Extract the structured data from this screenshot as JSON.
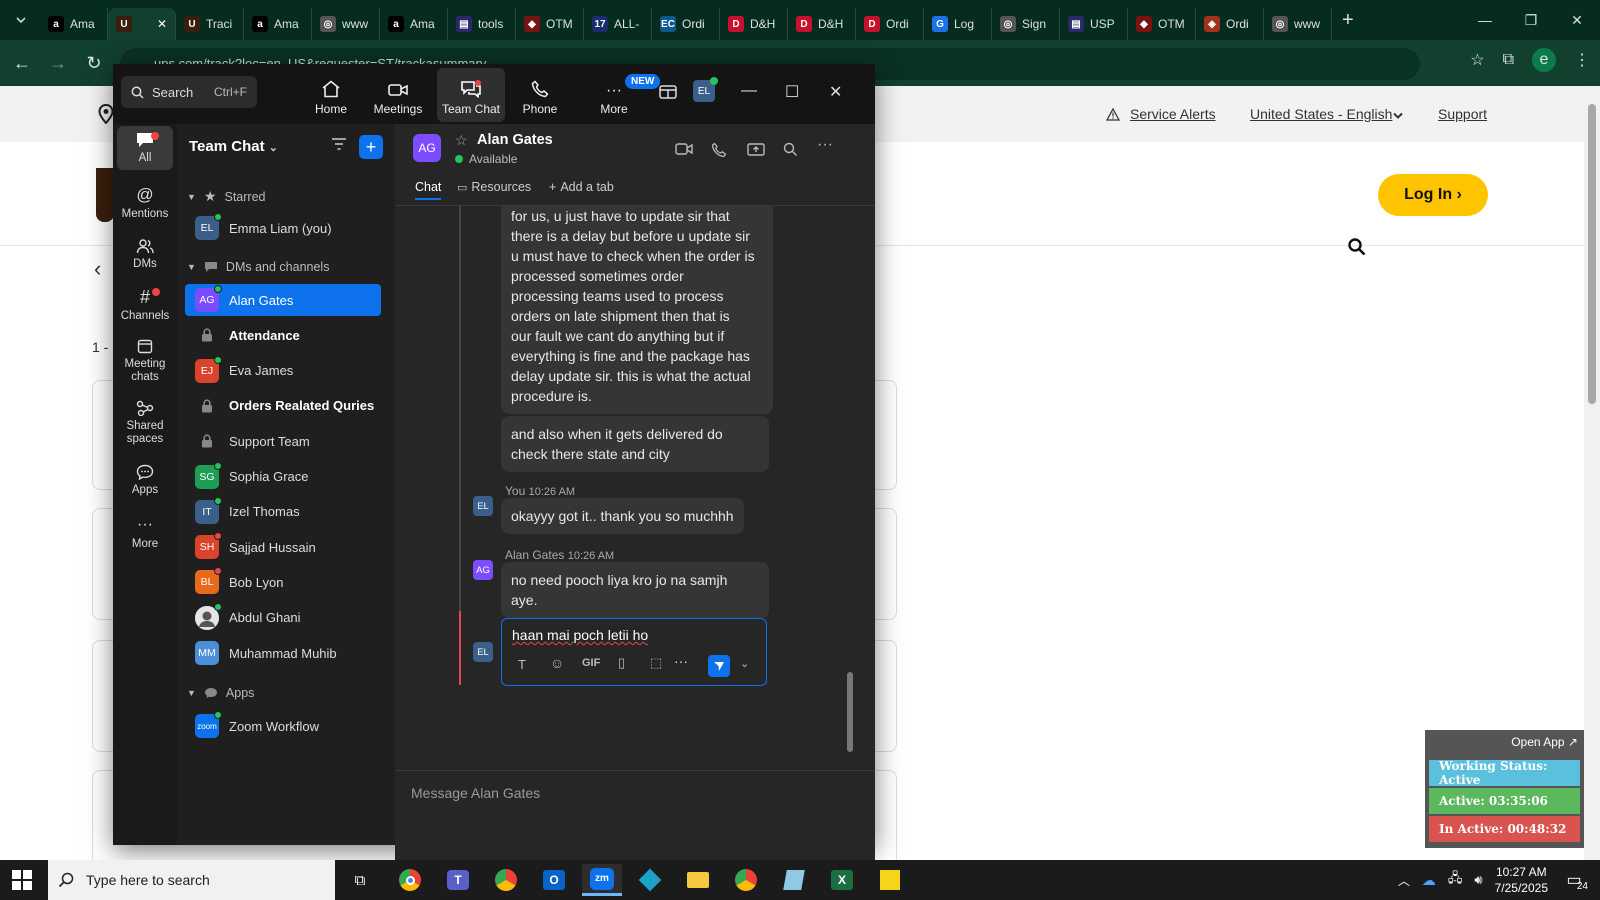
{
  "browser": {
    "tabs": [
      {
        "title": "Ama",
        "fav_color": "#000000",
        "fav_glyph": "a"
      },
      {
        "title": "",
        "fav_color": "#3b1f0e",
        "fav_glyph": "U"
      },
      {
        "title": "Traci",
        "fav_color": "#3b1f0e",
        "fav_glyph": "U"
      },
      {
        "title": "Ama",
        "fav_color": "#000000",
        "fav_glyph": "a"
      },
      {
        "title": "www",
        "fav_color": "#555555",
        "fav_glyph": "◎"
      },
      {
        "title": "Ama",
        "fav_color": "#000000",
        "fav_glyph": "a"
      },
      {
        "title": "tools",
        "fav_color": "#2a2a6a",
        "fav_glyph": "▤"
      },
      {
        "title": "OTM",
        "fav_color": "#7a1212",
        "fav_glyph": "◆"
      },
      {
        "title": "ALL-",
        "fav_color": "#1c2d6b",
        "fav_glyph": "17"
      },
      {
        "title": "Ordi",
        "fav_color": "#0b5a8c",
        "fav_glyph": "EC"
      },
      {
        "title": "D&H",
        "fav_color": "#c8102e",
        "fav_glyph": "D"
      },
      {
        "title": "D&H",
        "fav_color": "#c8102e",
        "fav_glyph": "D"
      },
      {
        "title": "Ordi",
        "fav_color": "#c8102e",
        "fav_glyph": "D"
      },
      {
        "title": "Log",
        "fav_color": "#1a73e8",
        "fav_glyph": "G"
      },
      {
        "title": "Sign",
        "fav_color": "#555555",
        "fav_glyph": "◎"
      },
      {
        "title": "USP",
        "fav_color": "#2a2a6a",
        "fav_glyph": "▤"
      },
      {
        "title": "OTM",
        "fav_color": "#7a1212",
        "fav_glyph": "◆"
      },
      {
        "title": "Ordi",
        "fav_color": "#a3321a",
        "fav_glyph": "◈"
      },
      {
        "title": "www",
        "fav_color": "#555555",
        "fav_glyph": "◎"
      }
    ],
    "url": "ups.com/track?loc=en_US&requester=ST/trackasummary",
    "profile_initial": "e"
  },
  "ups": {
    "service_alerts": "Service Alerts",
    "language": "United States - English",
    "support": "Support",
    "login": "Log In",
    "results_count": "1 - "
  },
  "zoom": {
    "search_placeholder": "Search",
    "search_shortcut": "Ctrl+F",
    "nav_tabs": [
      "Home",
      "Meetings",
      "Team Chat",
      "Phone",
      "More"
    ],
    "new_badge": "NEW",
    "user_initials": "EL",
    "rail": [
      "All",
      "Mentions",
      "DMs",
      "Channels",
      "Meeting chats",
      "Shared spaces",
      "Apps",
      "More"
    ],
    "sidebar": {
      "title": "Team Chat",
      "starred_label": "Starred",
      "starred_items": [
        {
          "initials": "EL",
          "name": "Emma Liam (you)",
          "color": "#3a5f8a",
          "presence": "available"
        }
      ],
      "dms_label": "DMs and channels",
      "dm_items": [
        {
          "initials": "AG",
          "name": "Alan Gates",
          "color": "#7c4dff",
          "type": "dm",
          "bold": false,
          "active": true,
          "presence": "available"
        },
        {
          "initials": "",
          "name": "Attendance",
          "color": "",
          "type": "channel",
          "bold": true,
          "active": false,
          "presence": ""
        },
        {
          "initials": "EJ",
          "name": "Eva James",
          "color": "#d9442b",
          "type": "dm",
          "bold": false,
          "active": false,
          "presence": "available"
        },
        {
          "initials": "",
          "name": "Orders Realated Quries",
          "color": "",
          "type": "channel",
          "bold": true,
          "active": false,
          "presence": ""
        },
        {
          "initials": "",
          "name": "Support Team",
          "color": "",
          "type": "channel",
          "bold": false,
          "active": false,
          "presence": ""
        },
        {
          "initials": "SG",
          "name": "Sophia Grace",
          "color": "#1f9d55",
          "type": "dm",
          "bold": false,
          "active": false,
          "presence": "available"
        },
        {
          "initials": "IT",
          "name": "Izel Thomas",
          "color": "#3a5f8a",
          "type": "dm",
          "bold": false,
          "active": false,
          "presence": "available"
        },
        {
          "initials": "SH",
          "name": "Sajjad Hussain",
          "color": "#d9442b",
          "type": "dm",
          "bold": false,
          "active": false,
          "presence": "busy"
        },
        {
          "initials": "BL",
          "name": "Bob Lyon",
          "color": "#e8691c",
          "type": "dm",
          "bold": false,
          "active": false,
          "presence": "busy"
        },
        {
          "initials": "",
          "name": "Abdul Ghani",
          "color": "#cccccc",
          "type": "photo",
          "bold": false,
          "active": false,
          "presence": "available"
        },
        {
          "initials": "MM",
          "name": "Muhammad Muhib",
          "color": "#4a8fd8",
          "type": "dm",
          "bold": false,
          "active": false,
          "presence": ""
        }
      ],
      "apps_label": "Apps",
      "app_items": [
        {
          "initials": "zoom",
          "name": "Zoom Workflow",
          "color": "#0e72ed",
          "presence": "available"
        }
      ]
    },
    "chat": {
      "contact_initials": "AG",
      "contact_name": "Alan Gates",
      "contact_status": "Available",
      "tabs": [
        "Chat",
        "Resources",
        "Add a tab"
      ],
      "messages": [
        {
          "lines": [
            "for us, u just have to update sir that",
            "there is a delay but before u update sir",
            "u must have to check when the order is",
            "processed sometimes order",
            "processing teams used to process",
            "orders on late shipment then that is",
            "our fault we cant do anything but if",
            "everything is fine and the package has",
            "delay update sir. this is what the actual",
            "procedure is."
          ]
        },
        {
          "lines": [
            "and also when it gets delivered do",
            "check there state and city"
          ]
        },
        {
          "sender": "You",
          "time": "10:26 AM",
          "initials": "EL",
          "lines": [
            "okayyy got it.. thank you so muchhh"
          ]
        },
        {
          "sender": "Alan Gates",
          "time": "10:26 AM",
          "initials": "AG",
          "lines": [
            "no need pooch liya kro jo na samjh",
            "aye."
          ]
        }
      ],
      "reply_initials": "EL",
      "reply_draft": "haan mai poch letii ho",
      "composer_placeholder": "Message Alan Gates",
      "gif_label": "GIF"
    }
  },
  "work_status": {
    "open_app": "Open App ↗",
    "status": "Working Status: Active",
    "active": "Active: 03:35:06",
    "inactive": "In Active: 00:48:32"
  },
  "taskbar": {
    "search_placeholder": "Type here to search",
    "time": "10:27 AM",
    "date": "7/25/2025",
    "notifications": "24"
  }
}
